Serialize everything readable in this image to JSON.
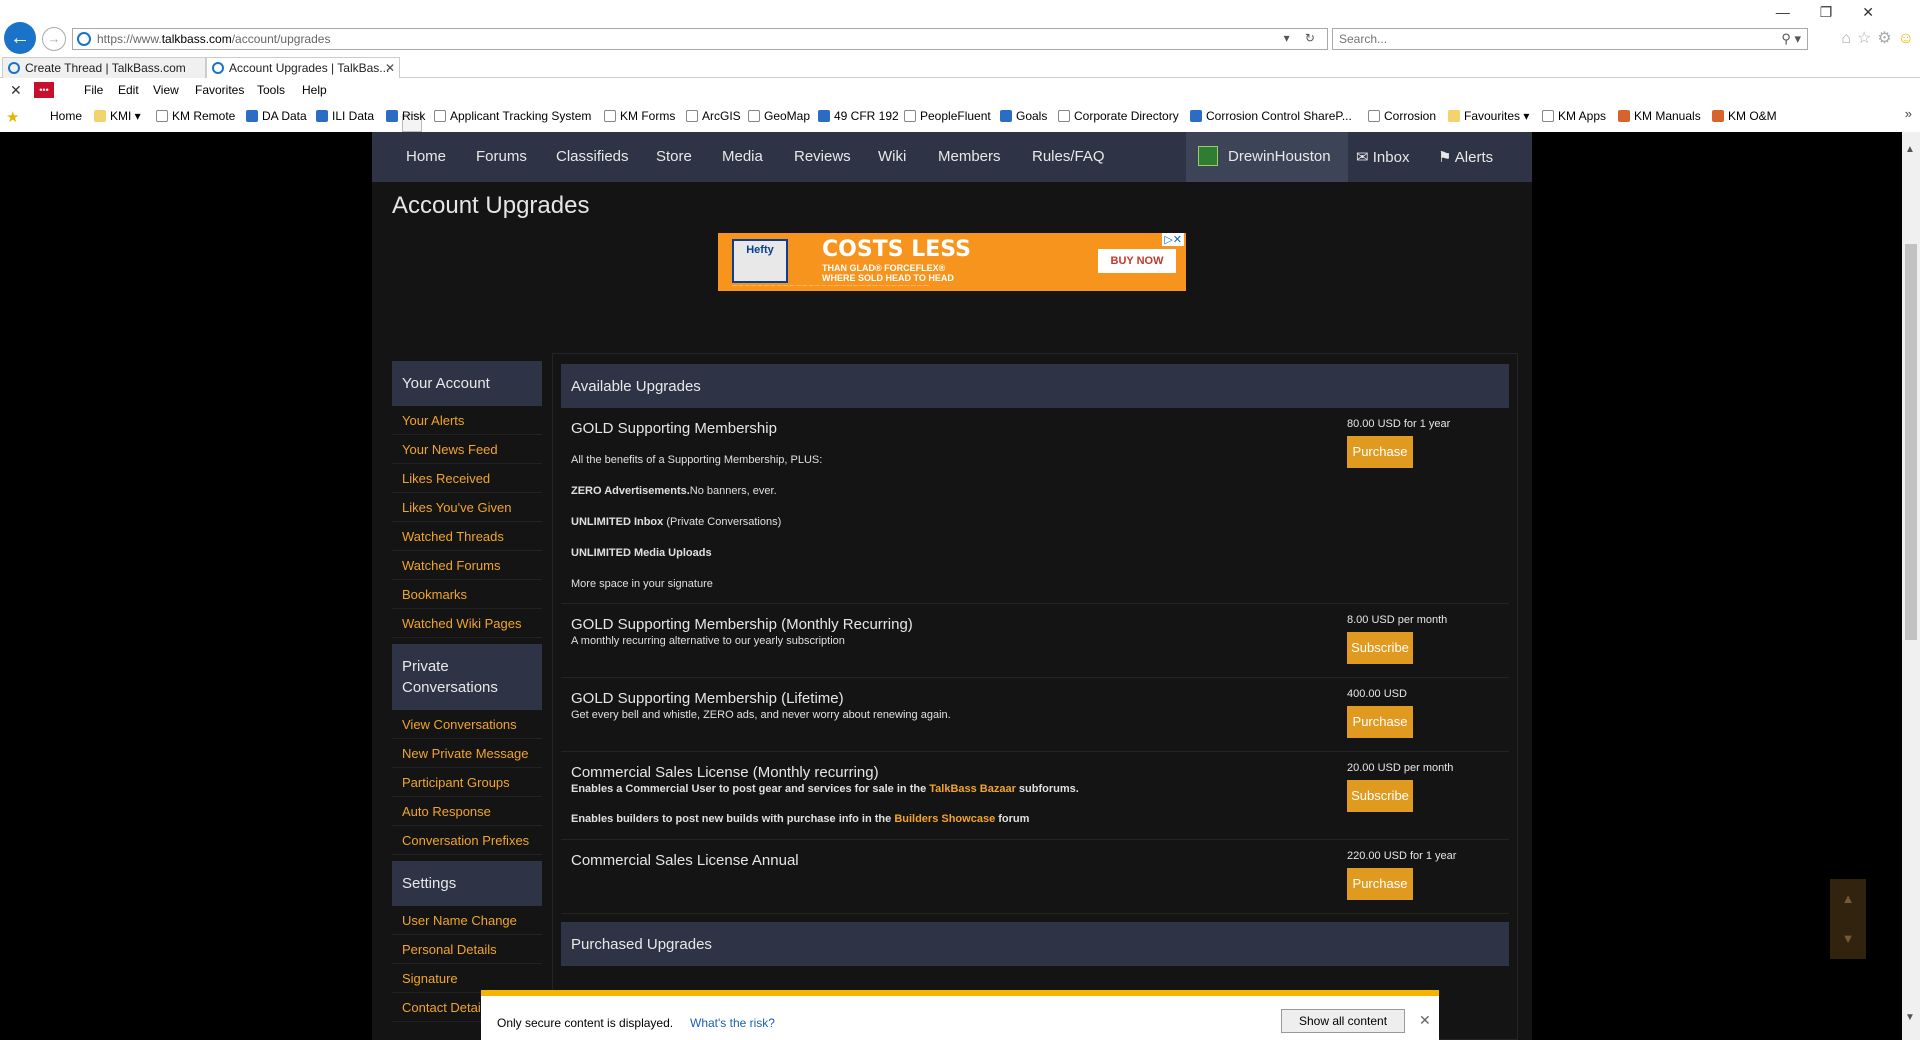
{
  "browser": {
    "url_prefix": "https://www.",
    "url_domain": "talkbass.com",
    "url_path": "/account/upgrades",
    "search_placeholder": "Search...",
    "tabs": [
      {
        "label": "Create Thread | TalkBass.com"
      },
      {
        "label": "Account Upgrades | TalkBas..."
      }
    ],
    "menu": [
      "File",
      "Edit",
      "View",
      "Favorites",
      "Tools",
      "Help"
    ],
    "favorites": [
      "Home",
      "KMI",
      "KM Remote",
      "DA Data",
      "ILI Data",
      "Risk",
      "Applicant Tracking System",
      "KM Forms",
      "ArcGIS",
      "GeoMap",
      "49 CFR 192",
      "PeopleFluent",
      "Goals",
      "Corporate Directory",
      "Corrosion Control ShareP...",
      "Corrosion",
      "Favourites",
      "KM Apps",
      "KM Manuals",
      "KM O&M"
    ]
  },
  "nav": {
    "items": [
      "Home",
      "Forums",
      "Classifieds",
      "Store",
      "Media",
      "Reviews",
      "Wiki",
      "Members",
      "Rules/FAQ"
    ],
    "username": "DrewinHouston",
    "inbox": "Inbox",
    "alerts": "Alerts"
  },
  "page_title": "Account Upgrades",
  "ad": {
    "brand": "Hefty",
    "headline": "COSTS LESS",
    "sub1": "THAN GLAD® FORCEFLEX®",
    "sub2": "WHERE SOLD HEAD TO HEAD",
    "cta": "BUY NOW"
  },
  "sidebar": {
    "your_account": {
      "heading": "Your Account",
      "links": [
        "Your Alerts",
        "Your News Feed",
        "Likes Received",
        "Likes You've Given",
        "Watched Threads",
        "Watched Forums",
        "Bookmarks",
        "Watched Wiki Pages"
      ]
    },
    "private_conversations": {
      "heading": "Private Conversations",
      "links": [
        "View Conversations",
        "New Private Message",
        "Participant Groups",
        "Auto Response",
        "Conversation Prefixes"
      ]
    },
    "settings": {
      "heading": "Settings",
      "links": [
        "User Name Change",
        "Personal Details",
        "Signature",
        "Contact Details"
      ]
    }
  },
  "available_heading": "Available Upgrades",
  "upgrades": [
    {
      "title": "GOLD Supporting Membership",
      "price": "80.00 USD for 1 year",
      "button": "Purchase",
      "intro": "All the benefits of a Supporting Membership, PLUS:",
      "f1_bold": "ZERO Advertisements.",
      "f1_rest": "No banners, ever.",
      "f2_bold": "UNLIMITED Inbox",
      "f2_rest": " (Private Conversations)",
      "f3_bold": "UNLIMITED Media Uploads",
      "f4": "More space in your signature"
    },
    {
      "title": "GOLD Supporting Membership (Monthly Recurring)",
      "price": "8.00 USD per month",
      "button": "Subscribe",
      "desc": "A monthly recurring alternative to our yearly subscription"
    },
    {
      "title": "GOLD Supporting Membership (Lifetime)",
      "price": "400.00 USD",
      "button": "Purchase",
      "desc": "Get every bell and whistle, ZERO ads, and never worry about renewing again."
    },
    {
      "title": "Commercial Sales License (Monthly recurring)",
      "price": "20.00 USD per month",
      "button": "Subscribe",
      "l1_a": "Enables a Commercial User to post gear and services for sale in the ",
      "l1_link": "TalkBass Bazaar",
      "l1_b": " subforums.",
      "l2_a": "Enables builders to post new builds with purchase info in the ",
      "l2_link": "Builders Showcase",
      "l2_b": " forum"
    },
    {
      "title": "Commercial Sales License Annual",
      "price": "220.00 USD for 1 year",
      "button": "Purchase"
    }
  ],
  "purchased_heading": "Purchased Upgrades",
  "notification": {
    "message": "Only secure content is displayed.",
    "risk_link": "What's the risk?",
    "show_button": "Show all content"
  }
}
